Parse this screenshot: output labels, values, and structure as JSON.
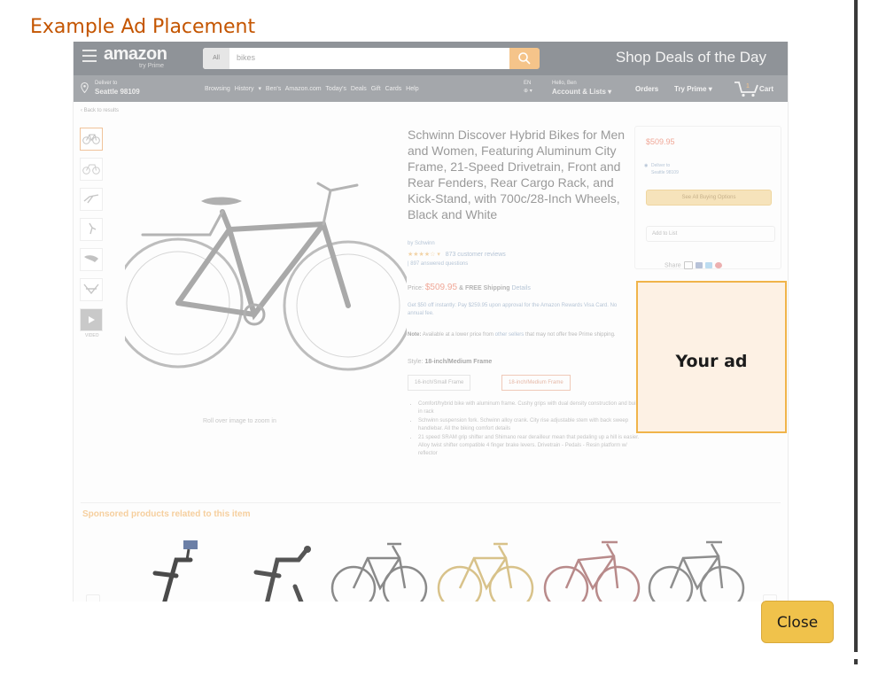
{
  "modal": {
    "title": "Example Ad Placement",
    "close_label": "Close",
    "colors": {
      "title": "#c45500",
      "close_button": "#f0c24b",
      "ad_border": "#f0b44a",
      "ad_bg": "#fdf1e4"
    }
  },
  "header": {
    "logo": "amazon",
    "logo_sub": "try Prime",
    "search_category": "All",
    "search_text": "bikes",
    "promo": "Shop Deals of the Day"
  },
  "subnav": {
    "deliver_line1": "Deliver to",
    "deliver_line2": "Seattle 98109",
    "links": "Browsing History ▾   Ben's Amazon.com   Today's Deals   Gift Cards   Help",
    "lang": "EN",
    "account_line1": "Hello, Ben",
    "account_line2": "Account & Lists ▾",
    "orders": "Orders",
    "prime": "Try Prime ▾",
    "cart": "Cart"
  },
  "product": {
    "back_link": "‹ Back to results",
    "title": "Schwinn Discover Hybrid Bikes for Men and Women, Featuring Aluminum City Frame, 21-Speed Drivetrain, Front and Rear Fenders, Rear Cargo Rack, and Kick-Stand, with 700c/28-Inch Wheels, Black and White",
    "brand": "by Schwinn",
    "stars": "★★★★☆",
    "reviews": "873 customer reviews",
    "answered": "| 897 answered questions",
    "price_label": "Price:",
    "price": "$509.95",
    "shipping": "& FREE Shipping",
    "details": "Details",
    "reward": "Get $50 off instantly: Pay $259.95 upon approval for the Amazon Rewards Visa Card. No annual fee.",
    "note_label": "Note:",
    "note_text": "Available at a lower price from",
    "note_link": "other sellers",
    "note_tail": "that may not offer free Prime shipping.",
    "style_label": "Style:",
    "style_value": "18-inch/Medium Frame",
    "style_options": [
      "16-inch/Small Frame",
      "18-inch/Medium Frame"
    ],
    "bullets": [
      "Comfort/hybrid bike with aluminum frame. Cushy grips with dual density construction and built in rack",
      "Schwinn suspension fork. Schwinn alloy crank. City rise adjustable stem with back sweep handlebar. All the biking comfort details",
      "21 speed SRAM grip shifter and Shimano rear derailleur mean that pedaling up a hill is easier. Alloy twist shifter compatible 4 finger brake levers. Drivetrain - Pedals - Resin platform w/ reflector"
    ],
    "zoom_note": "Roll over image to zoom in",
    "video_label": "VIDEO"
  },
  "buybox": {
    "price": "$509.95",
    "deliver_line1": "Deliver to",
    "deliver_line2": "Seattle 98109",
    "see_all": "See All Buying Options",
    "add_list": "Add to List",
    "share": "Share"
  },
  "ad": {
    "text": "Your ad"
  },
  "sponsored": {
    "heading": "Sponsored products related to this item"
  }
}
